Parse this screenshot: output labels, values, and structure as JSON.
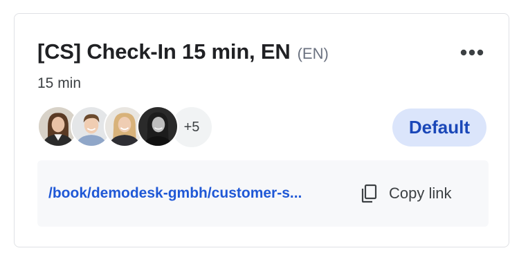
{
  "event": {
    "title": "[CS] Check-In 15 min, EN",
    "language": "(EN)",
    "duration": "15 min",
    "more_menu_icon": "more-horizontal-icon"
  },
  "hosts": {
    "avatars": [
      {
        "name": "host-avatar-1",
        "hair": "#5a3a24",
        "skin": "#e9c2a6",
        "bg": "#d8d2c8",
        "shirt": "#2b2b2b"
      },
      {
        "name": "host-avatar-2",
        "hair": "#6b4a2e",
        "skin": "#f0cdb2",
        "bg": "#e4e6e8",
        "shirt": "#8fa6c8"
      },
      {
        "name": "host-avatar-3",
        "hair": "#d8b27a",
        "skin": "#efcdb3",
        "bg": "#e9e6e1",
        "shirt": "#2e2e33"
      },
      {
        "name": "host-avatar-4",
        "hair": "#1c1c1c",
        "skin": "#bdbdbd",
        "bg": "#2a2a2a",
        "shirt": "#111111"
      }
    ],
    "more_count": "+5"
  },
  "badge": {
    "label": "Default",
    "bg_color": "#dbe5fb",
    "text_color": "#1a47b8"
  },
  "link": {
    "url": "/book/demodesk-gmbh/customer-s...",
    "copy_label": "Copy link",
    "copy_icon": "copy-icon",
    "link_color": "#1f58d6"
  }
}
